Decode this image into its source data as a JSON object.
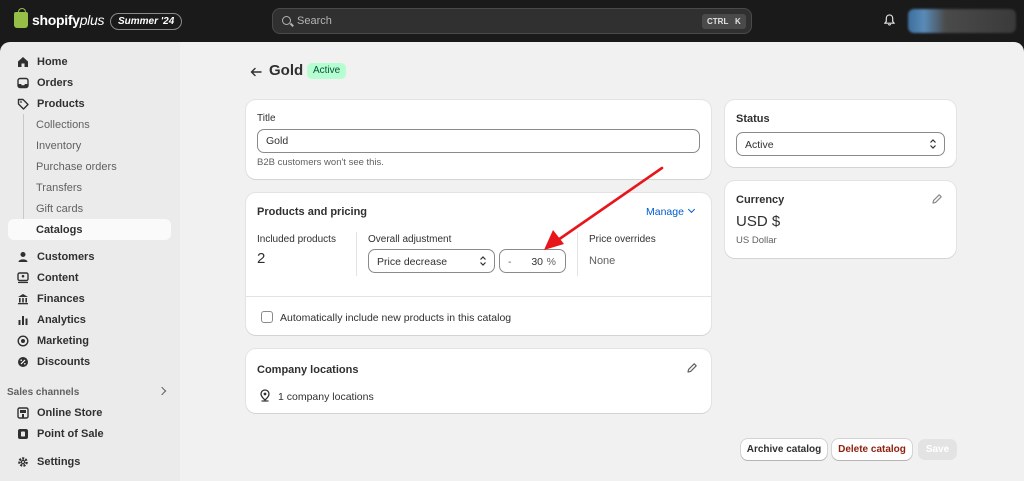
{
  "topbar": {
    "brand_bold": "shopify",
    "brand_light": "plus",
    "edition_badge": "Summer '24",
    "search_placeholder": "Search",
    "kbd_ctrl": "CTRL",
    "kbd_k": "K"
  },
  "sidebar": {
    "items": [
      {
        "label": "Home",
        "icon": "home-icon"
      },
      {
        "label": "Orders",
        "icon": "inbox-icon"
      },
      {
        "label": "Products",
        "icon": "tag-icon"
      }
    ],
    "product_sub": [
      {
        "label": "Collections"
      },
      {
        "label": "Inventory"
      },
      {
        "label": "Purchase orders"
      },
      {
        "label": "Transfers"
      },
      {
        "label": "Gift cards"
      },
      {
        "label": "Catalogs",
        "active": true
      }
    ],
    "items2": [
      {
        "label": "Customers",
        "icon": "person-icon"
      },
      {
        "label": "Content",
        "icon": "content-icon"
      },
      {
        "label": "Finances",
        "icon": "bank-icon"
      },
      {
        "label": "Analytics",
        "icon": "bar-chart-icon"
      },
      {
        "label": "Marketing",
        "icon": "target-icon"
      },
      {
        "label": "Discounts",
        "icon": "discount-icon"
      }
    ],
    "sales_channels_label": "Sales channels",
    "channels": [
      {
        "label": "Online Store",
        "icon": "store-icon"
      },
      {
        "label": "Point of Sale",
        "icon": "pos-icon"
      }
    ],
    "settings_label": "Settings"
  },
  "page": {
    "title": "Gold",
    "status_badge": "Active"
  },
  "title_card": {
    "label": "Title",
    "value": "Gold",
    "help": "B2B customers won't see this."
  },
  "pricing_card": {
    "title": "Products and pricing",
    "manage_label": "Manage",
    "included_label": "Included products",
    "included_value": "2",
    "adjustment_label": "Overall adjustment",
    "adjustment_type": "Price decrease",
    "adjustment_sign": "-",
    "adjustment_value": "30",
    "adjustment_unit": "%",
    "overrides_label": "Price overrides",
    "overrides_value": "None",
    "auto_include_label": "Automatically include new products in this catalog"
  },
  "locations_card": {
    "title": "Company locations",
    "count_text": "1 company locations"
  },
  "status_card": {
    "title": "Status",
    "value": "Active"
  },
  "currency_card": {
    "title": "Currency",
    "code": "USD $",
    "name": "US Dollar"
  },
  "actions": {
    "archive": "Archive catalog",
    "delete": "Delete catalog",
    "save": "Save"
  },
  "colors": {
    "annotation_arrow": "#e8161b",
    "accent_link": "#005bd3",
    "badge_bg": "#b4fed2"
  }
}
